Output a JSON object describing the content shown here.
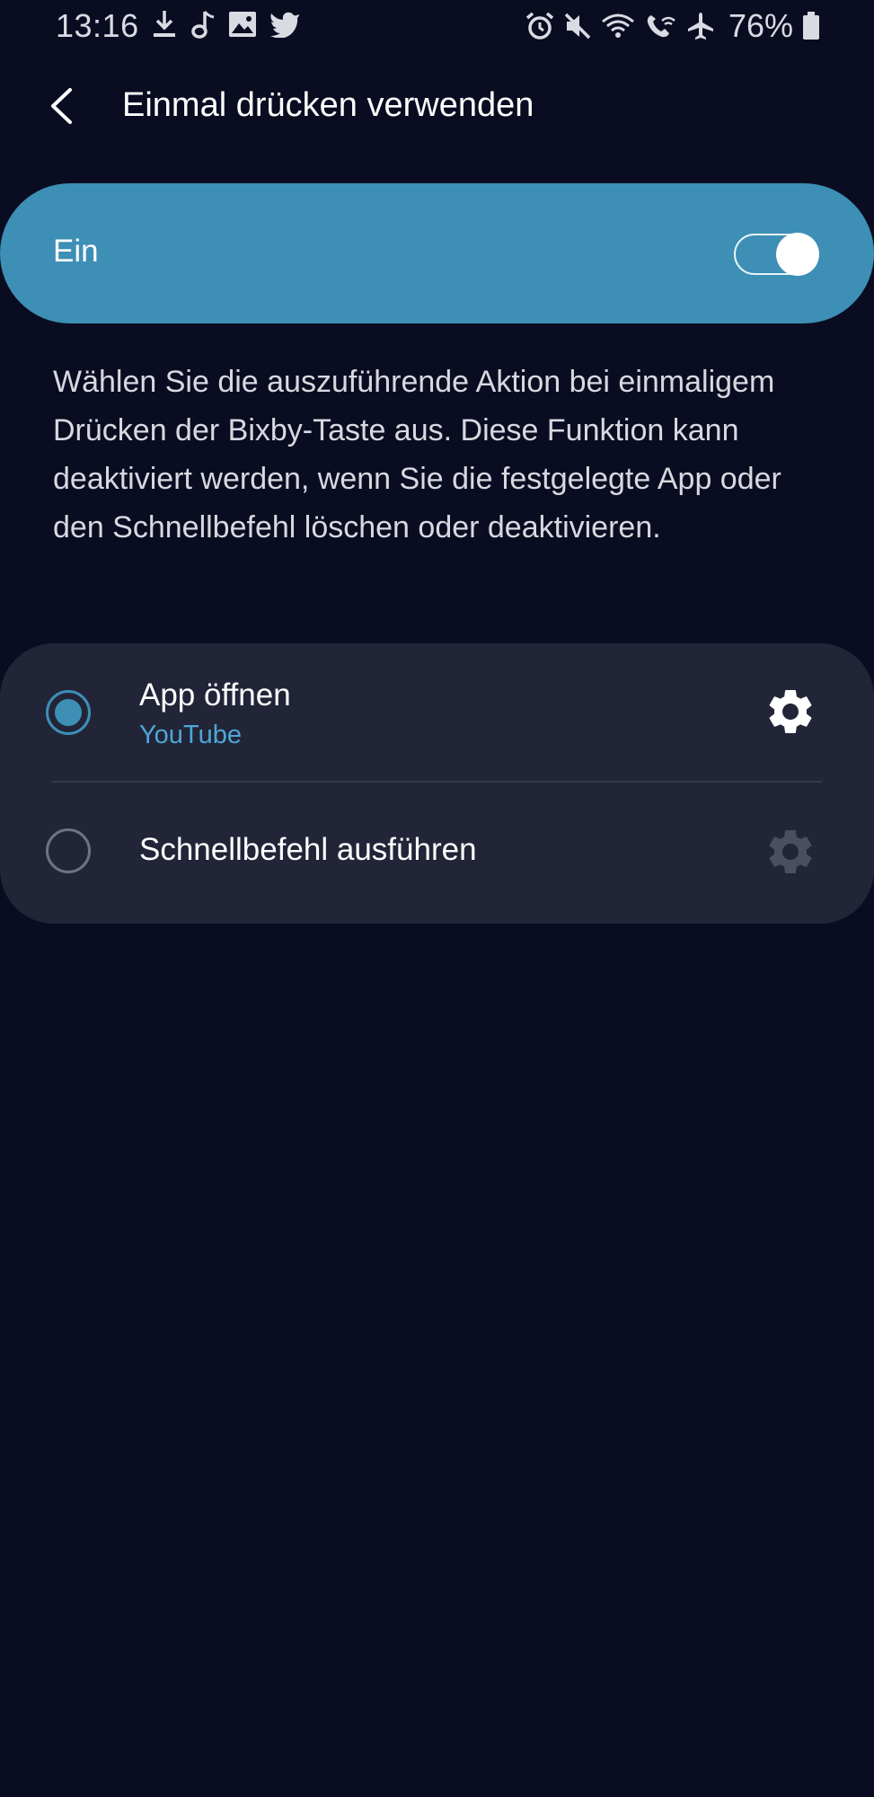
{
  "status_bar": {
    "time": "13:16",
    "left_icons": [
      "download-icon",
      "music-note-icon",
      "image-icon",
      "twitter-icon"
    ],
    "right_icons": [
      "alarm-icon",
      "mute-icon",
      "wifi-icon",
      "wifi-calling-icon",
      "airplane-icon",
      "battery-icon"
    ],
    "battery_percent": "76%"
  },
  "header": {
    "title": "Einmal drücken verwenden",
    "back_icon": "chevron-left-icon"
  },
  "master_switch": {
    "label": "Ein",
    "state": true,
    "color": "#3d8fb5"
  },
  "description": "Wählen Sie die auszuführende Aktion bei einmaligem Drücken der Bixby-Taste aus. Diese Funktion kann deaktiviert werden, wenn Sie die festgelegte App oder den Schnellbefehl löschen oder deaktivieren.",
  "options": [
    {
      "title": "App öffnen",
      "subtitle": "YouTube",
      "selected": true,
      "settings_icon": "gear-icon",
      "settings_enabled": true
    },
    {
      "title": "Schnellbefehl ausführen",
      "selected": false,
      "settings_icon": "gear-icon",
      "settings_enabled": false
    }
  ],
  "colors": {
    "background": "#0a0d21",
    "card": "#222538",
    "accent": "#3d8fb5",
    "subtitle": "#4da7d6"
  }
}
